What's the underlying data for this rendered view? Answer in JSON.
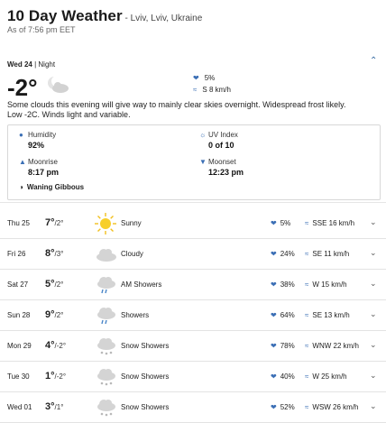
{
  "header": {
    "title": "10 Day Weather",
    "location": " - Lviv, Lviv, Ukraine",
    "as_of": "As of 7:56 pm EET"
  },
  "today": {
    "date": "Wed 24",
    "part": " | Night",
    "temp": "-2°",
    "precip": "5%",
    "wind": "S 8 km/h",
    "description": "Some clouds this evening will give way to mainly clear skies overnight. Widespread frost likely. Low -2C. Winds light and variable.",
    "humidity_label": "Humidity",
    "humidity_value": "92%",
    "uv_label": "UV Index",
    "uv_value": "0 of 10",
    "moonrise_label": "Moonrise",
    "moonrise_value": "8:17 pm",
    "moonset_label": "Moonset",
    "moonset_value": "12:23 pm",
    "moon_phase": "Waning Gibbous"
  },
  "days": [
    {
      "day": "Thu 25",
      "hi": "7°",
      "lo": "/2°",
      "icon": "sun-icon",
      "phrase": "Sunny",
      "precip": "5%",
      "wind": "SSE 16 km/h"
    },
    {
      "day": "Fri 26",
      "hi": "8°",
      "lo": "/3°",
      "icon": "cloud-icon",
      "phrase": "Cloudy",
      "precip": "24%",
      "wind": "SE 11 km/h"
    },
    {
      "day": "Sat 27",
      "hi": "5°",
      "lo": "/2°",
      "icon": "rain-cloud-icon",
      "phrase": "AM Showers",
      "precip": "38%",
      "wind": "W 15 km/h"
    },
    {
      "day": "Sun 28",
      "hi": "9°",
      "lo": "/2°",
      "icon": "rain-cloud-icon",
      "phrase": "Showers",
      "precip": "64%",
      "wind": "SE 13 km/h"
    },
    {
      "day": "Mon 29",
      "hi": "4°",
      "lo": "/-2°",
      "icon": "snow-cloud-icon",
      "phrase": "Snow Showers",
      "precip": "78%",
      "wind": "WNW 22 km/h"
    },
    {
      "day": "Tue 30",
      "hi": "1°",
      "lo": "/-2°",
      "icon": "snow-cloud-icon",
      "phrase": "Snow Showers",
      "precip": "40%",
      "wind": "W 25 km/h"
    },
    {
      "day": "Wed 01",
      "hi": "3°",
      "lo": "/1°",
      "icon": "snow-cloud-icon",
      "phrase": "Snow Showers",
      "precip": "52%",
      "wind": "WSW 26 km/h"
    }
  ]
}
